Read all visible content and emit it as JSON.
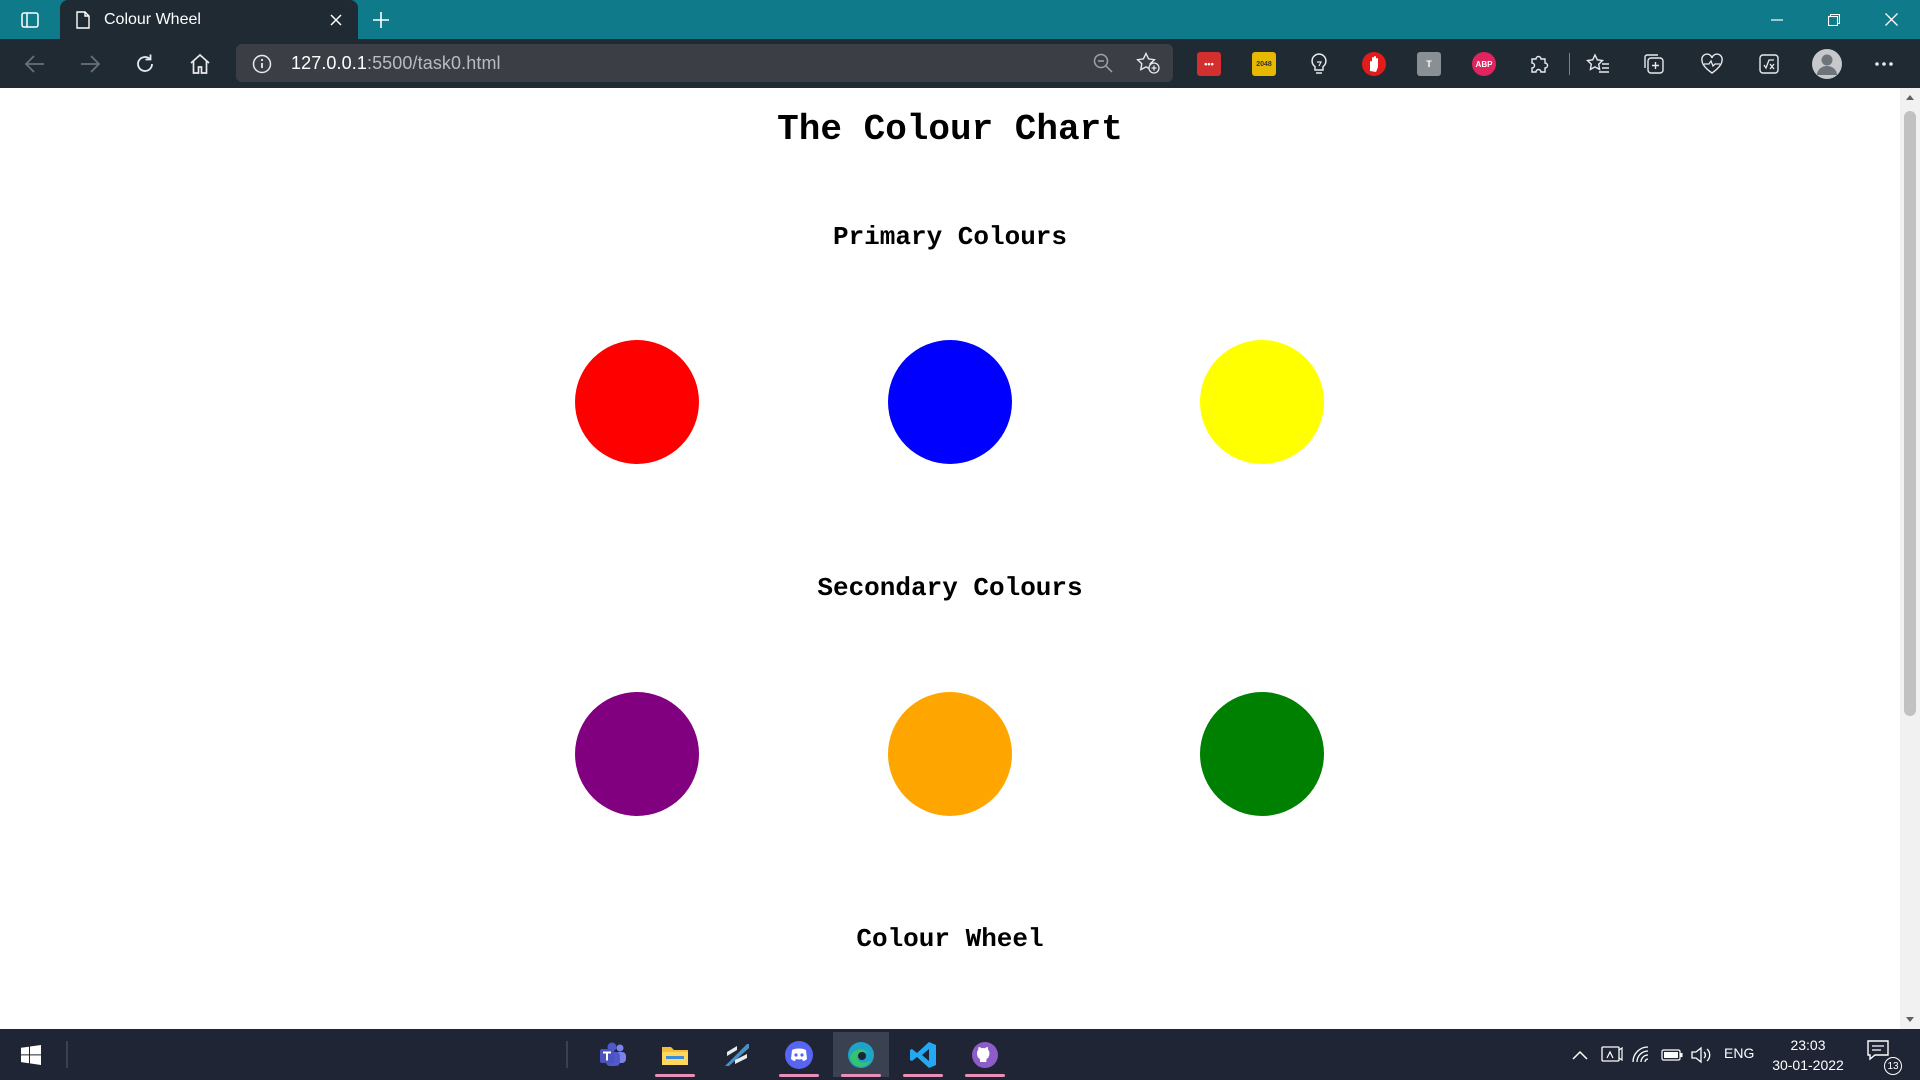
{
  "browser": {
    "tab_title": "Colour Wheel",
    "url_host": "127.0.0.1",
    "url_rest": ":5500/task0.html",
    "theme_color": "#0e7a8a",
    "extensions": [
      {
        "name": "dots-extension-icon",
        "label": "•••",
        "color": "#d32f2f"
      },
      {
        "name": "2048-extension-icon",
        "label": "2048",
        "color": "#e6b800"
      },
      {
        "name": "bulb-extension-icon",
        "label": "",
        "color": "#202a33"
      },
      {
        "name": "hand-extension-icon",
        "label": "",
        "color": "#e21b1b"
      },
      {
        "name": "translate-extension-icon",
        "label": "T",
        "color": "#8a8f96"
      },
      {
        "name": "adblock-plus-icon",
        "label": "ABP",
        "color": "#e0245e"
      }
    ]
  },
  "page": {
    "title": "The Colour Chart",
    "sections": [
      {
        "heading": "Primary Colours",
        "colors": [
          "#ff0000",
          "#0000ff",
          "#ffff00"
        ]
      },
      {
        "heading": "Secondary Colours",
        "colors": [
          "#800080",
          "#ffa500",
          "#008000"
        ]
      },
      {
        "heading": "Colour Wheel"
      }
    ]
  },
  "taskbar": {
    "apps": [
      {
        "name": "teams-app",
        "color": "#6264a7"
      },
      {
        "name": "file-explorer-app",
        "color": "#f3c03d"
      },
      {
        "name": "sublime-app",
        "color": "#4a90c4"
      },
      {
        "name": "discord-app",
        "color": "#5865f2"
      },
      {
        "name": "edge-app",
        "color": "#1fa3c8"
      },
      {
        "name": "vscode-app",
        "color": "#23a9f2"
      },
      {
        "name": "github-desktop-app",
        "color": "#8e5cc8"
      }
    ],
    "language": "ENG",
    "time": "23:03",
    "date": "30-01-2022",
    "notification_count": "13"
  }
}
